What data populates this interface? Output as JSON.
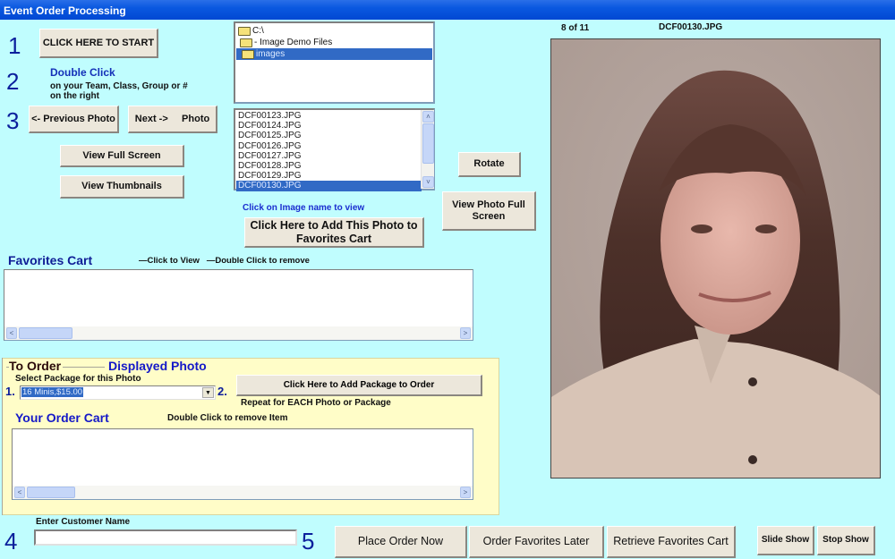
{
  "window": {
    "title": "Event Order Processing"
  },
  "steps": {
    "s1": "1",
    "s2": "2",
    "s3": "3",
    "s4": "4",
    "s5": "5"
  },
  "buttons": {
    "start": "CLICK HERE TO START",
    "previous": "<- Previous  Photo",
    "next": "Next ->     Photo",
    "view_full_screen": "View Full Screen",
    "view_thumbnails": "View Thumbnails",
    "rotate": "Rotate",
    "view_photo_full_screen": "View Photo Full Screen",
    "add_to_favorites": "Click Here to Add This Photo to Favorites Cart",
    "add_package": "Click Here to Add Package to Order",
    "place_order": "Place Order Now",
    "order_favorites_later": "Order Favorites Later",
    "retrieve_favorites": "Retrieve Favorites Cart",
    "slide_show": "Slide Show",
    "stop_show": "Stop Show"
  },
  "instructions": {
    "double_click": "Double Click",
    "double_click_sub": "on your Team, Class, Group or # on the right",
    "click_image_name": "Click on Image name to view",
    "favorites_hint": "—Click to View   —Double Click to remove",
    "order_hint": "Double Click to remove Item",
    "repeat_hint": "Repeat for EACH Photo or Package",
    "select_package": "Select Package for this Photo"
  },
  "folder_tree": [
    {
      "label": "C:\\",
      "selected": false
    },
    {
      "label": "- Image Demo Files",
      "selected": false
    },
    {
      "label": "images",
      "selected": true
    }
  ],
  "file_list": [
    {
      "name": "DCF00123.JPG",
      "selected": false
    },
    {
      "name": "DCF00124.JPG",
      "selected": false
    },
    {
      "name": "DCF00125.JPG",
      "selected": false
    },
    {
      "name": "DCF00126.JPG",
      "selected": false
    },
    {
      "name": "DCF00127.JPG",
      "selected": false
    },
    {
      "name": "DCF00128.JPG",
      "selected": false
    },
    {
      "name": "DCF00129.JPG",
      "selected": false
    },
    {
      "name": "DCF00130.JPG",
      "selected": true
    }
  ],
  "favorites": {
    "title": "Favorites Cart",
    "items": []
  },
  "order": {
    "title": "To Order",
    "subtitle": "Displayed Photo",
    "num1": "1.",
    "num2": "2.",
    "package_selected": "16 Minis,$15.00",
    "cart_title": "Your Order Cart",
    "cart_items": []
  },
  "customer": {
    "label": "Enter Customer Name",
    "value": ""
  },
  "viewer": {
    "position": "8 of 11",
    "filename": "DCF00130.JPG"
  },
  "icons": {
    "folder": "folder-icon",
    "scroll_up": "˄",
    "scroll_down": "˅",
    "scroll_left": "<",
    "scroll_right": ">",
    "dropdown": "▼"
  }
}
